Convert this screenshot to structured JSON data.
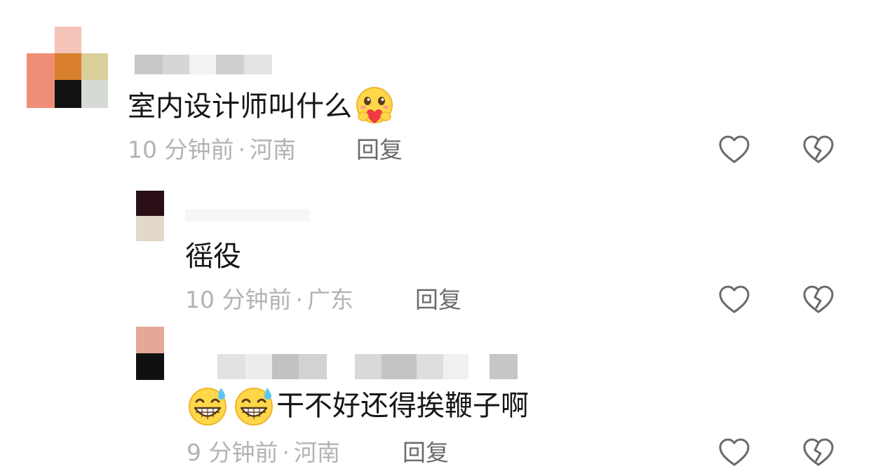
{
  "comments": [
    {
      "text": "室内设计师叫什么",
      "emoji_suffix": "hug-heart-emoji",
      "time": "10 分钟前",
      "location": "河南",
      "reply_label": "回复"
    },
    {
      "text": "徭役",
      "time": "10 分钟前",
      "location": "广东",
      "reply_label": "回复"
    },
    {
      "text": "干不好还得挨鞭子啊",
      "emoji_prefix": [
        "grin-sweat-emoji",
        "grin-sweat-emoji"
      ],
      "time": "9 分钟前",
      "location": "河南",
      "reply_label": "回复"
    }
  ],
  "meta_separator": "·",
  "icons": {
    "like": "heart-outline-icon",
    "dislike": "broken-heart-icon"
  },
  "colors": {
    "meta": "#b3b3b3",
    "reply": "#6b6b6b",
    "text": "#161616",
    "icon": "#6a6a6a"
  }
}
